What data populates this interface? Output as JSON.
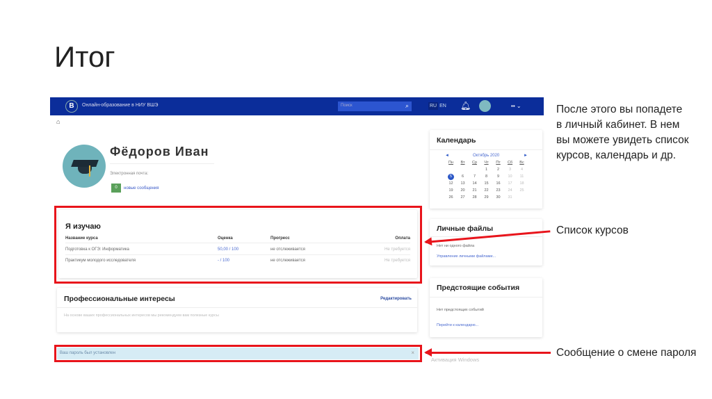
{
  "slide": {
    "title": "Итог",
    "description_lines": [
      "После этого вы попадете",
      "в личный кабинет. В нем",
      "вы можете увидеть список",
      "курсов, календарь и др."
    ],
    "label_courses": "Список курсов",
    "label_password": "Сообщение о смене пароля"
  },
  "header": {
    "brand": "Онлайн-образование в НИУ ВШЭ",
    "search_placeholder": "Поиск",
    "lang_ru": "RU",
    "lang_en": "EN"
  },
  "profile": {
    "name": "Фёдоров Иван",
    "email_label": "Электронная почта:",
    "new_messages_count": "0",
    "new_messages_label": "новые сообщения"
  },
  "courses": {
    "title": "Я изучаю",
    "headers": [
      "Название курса",
      "Оценка",
      "Прогресс",
      "Оплата"
    ],
    "rows": [
      {
        "name": "Подготовка к ОГЭ: Информатика",
        "grade": "50,00 / 100",
        "progress": "не отслеживается",
        "payment": "Не требуется"
      },
      {
        "name": "Практикум молодого исследователя",
        "grade": "- / 100",
        "progress": "не отслеживается",
        "payment": "Не требуется"
      }
    ]
  },
  "interests": {
    "title": "Профессиональные интересы",
    "edit": "Редактировать",
    "text": "На основе ваших профессиональных интересов мы рекомендуем вам полезные курсы"
  },
  "alert": {
    "text": "Ваш пароль был установлен",
    "close": "×"
  },
  "calendar": {
    "title": "Календарь",
    "month": "Октябрь 2020",
    "prev": "◄",
    "next": "►",
    "weekdays": [
      "Пн",
      "Вт",
      "Ср",
      "Чт",
      "Пт",
      "Сб",
      "Вс"
    ],
    "weeks": [
      [
        "",
        "",
        "",
        "1",
        "2",
        "3",
        "4"
      ],
      [
        "5",
        "6",
        "7",
        "8",
        "9",
        "10",
        "11"
      ],
      [
        "12",
        "13",
        "14",
        "15",
        "16",
        "17",
        "18"
      ],
      [
        "19",
        "20",
        "21",
        "22",
        "23",
        "24",
        "25"
      ],
      [
        "26",
        "27",
        "28",
        "29",
        "30",
        "31",
        ""
      ]
    ],
    "today": "5"
  },
  "files": {
    "title": "Личные файлы",
    "empty": "Нет ни одного файла",
    "link": "Управление личными файлами..."
  },
  "events": {
    "title": "Предстоящие события",
    "empty": "Нет предстоящих событий",
    "link": "Перейти к календарю..."
  },
  "watermark": "Активация Windows"
}
